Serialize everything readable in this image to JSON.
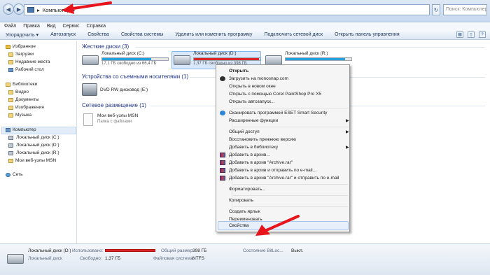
{
  "address": {
    "location": "Компьютер"
  },
  "search": {
    "placeholder": "Поиск: Компьютер"
  },
  "menubar": [
    "Файл",
    "Правка",
    "Вид",
    "Сервис",
    "Справка"
  ],
  "toolbar": {
    "organize": "Упорядочить ▾",
    "autoplay": "Автозапуск",
    "properties": "Свойства",
    "system_properties": "Свойства системы",
    "uninstall": "Удалить или изменить программу",
    "map_drive": "Подключить сетевой диск",
    "control_panel": "Открыть панель управления"
  },
  "sidebar": {
    "favorites": "Избранное",
    "downloads": "Загрузки",
    "recent": "Недавние места",
    "desktop": "Рабочий стол",
    "libraries": "Библиотеки",
    "video": "Видео",
    "documents": "Документы",
    "images": "Изображения",
    "music": "Музыка",
    "computer": "Компьютер",
    "disk_c": "Локальный диск (C:)",
    "disk_d": "Локальный диск (D:)",
    "disk_r": "Локальный диск (R:)",
    "msn": "Мои веб-узлы MSN",
    "network": "Сеть"
  },
  "groups": {
    "hard_disks": "Жесткие диски (3)",
    "removable": "Устройства со съемными носителями (1)",
    "network": "Сетевое размещение (1)"
  },
  "drives": [
    {
      "name": "Локальный диск (C:)",
      "free": "17,1 ГБ свободно из 66,4 ГБ",
      "used_fraction": 0.74
    },
    {
      "name": "Локальный диск (D:)",
      "free": "1,37 ГБ свободно из 398 ГБ",
      "used_fraction": 0.99
    },
    {
      "name": "Локальный диск (R:)",
      "free": "",
      "used_fraction": 0.9
    }
  ],
  "dvd": {
    "name": "DVD RW дисковод (E:)"
  },
  "netfolder": {
    "name": "Мои веб-узлы MSN",
    "type": "Папка с файлами"
  },
  "context_menu": {
    "open": "Открыть",
    "monosnap": "Загрузить на monosnap.com",
    "open_new_window": "Открыть в новом окне",
    "open_corel": "Открыть с помощью Corel PaintShop Pro X5",
    "open_autoplay": "Открыть автозапуск...",
    "eset": "Сканировать программой ESET Smart Security",
    "extended": "Расширенные функции",
    "share": "Общий доступ",
    "restore": "Восстановить прежнюю версию",
    "add_library": "Добавить в библиотеку",
    "add_archive": "Добавить в архив...",
    "add_archive_rar": "Добавить в архив \"Archive.rar\"",
    "add_archive_email": "Добавить в архив и отправить по e-mail...",
    "add_rar_email": "Добавить в архив \"Archive.rar\" и отправить по e-mail",
    "format": "Форматировать...",
    "copy": "Копировать",
    "shortcut": "Создать ярлык",
    "rename": "Переименовать",
    "properties": "Свойства"
  },
  "status": {
    "name": "Локальный диск (D:)",
    "type": "Локальный диск",
    "used_label": "Использовано:",
    "free_label": "Свободно:",
    "free_value": "1,37 ГБ",
    "total_label": "Общий размер:",
    "total_value": "398 ГБ",
    "fs_label": "Файловая система:",
    "fs_value": "NTFS",
    "bitlocker_label": "Состояние BitLoc...",
    "bitlocker_value": "Выкл."
  },
  "colors": {
    "annotation_arrow": "#e8141b",
    "link_blue": "#1e3287",
    "drive_bar": "#26a0da",
    "drive_bar_full": "#da2626"
  }
}
